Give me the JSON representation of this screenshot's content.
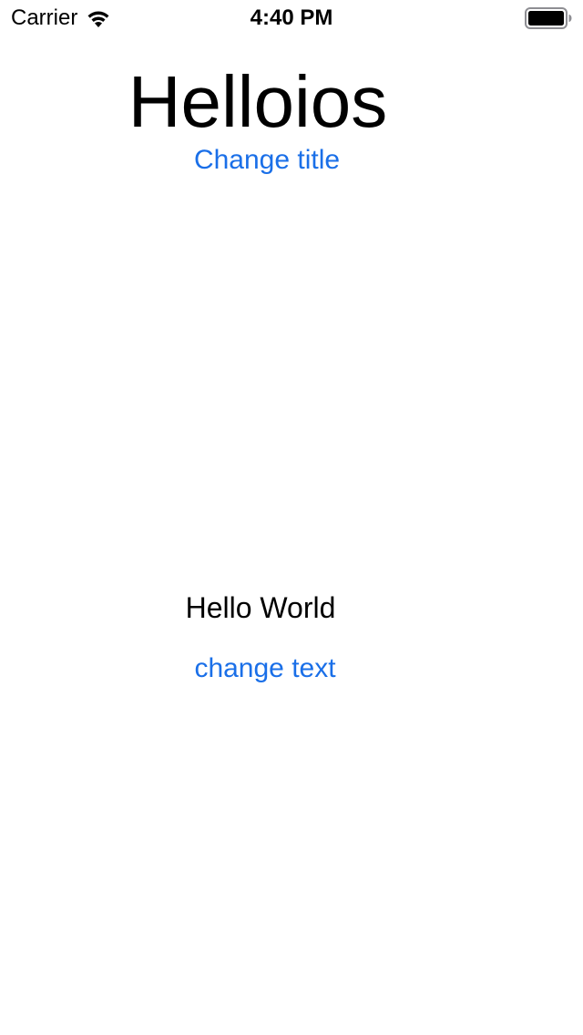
{
  "status_bar": {
    "carrier": "Carrier",
    "time": "4:40 PM",
    "wifi_icon": "wifi-icon",
    "battery_icon": "battery-icon"
  },
  "main": {
    "title": "Helloios",
    "change_title_label": "Change title",
    "message": "Hello World",
    "change_text_label": "change text"
  },
  "colors": {
    "accent": "#1a6fe8",
    "text": "#000000",
    "background": "#ffffff"
  }
}
